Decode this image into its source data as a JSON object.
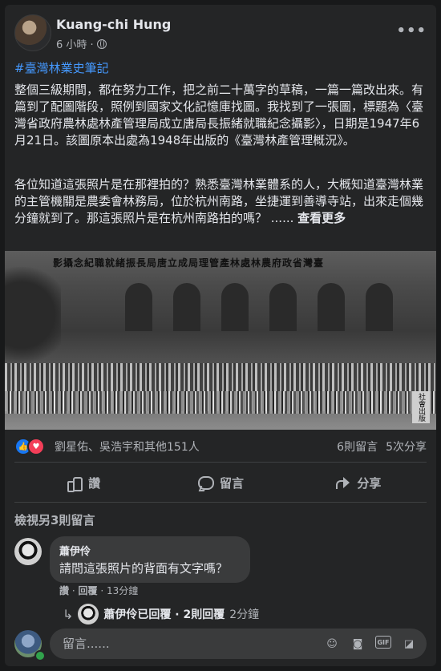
{
  "post": {
    "author": "Kuang-chi Hung",
    "time": "6 小時 ·",
    "hashtag": "#臺灣林業史筆記",
    "paragraph1": "整個三級期間，都在努力工作，把之前二十萬字的草稿，一篇一篇改出來。有篇到了配圖階段，照例到國家文化記憶庫找圖。我找到了一張圖，標題為〈臺灣省政府農林處林產管理局成立唐局長振緒就職紀念攝影〉，日期是1947年6月21日。該圖原本出處為1948年出版的《臺灣林產管理概況》。",
    "paragraph2": "各位知道這張照片是在那裡拍的？熟悉臺灣林業體系的人，大概知道臺灣林業的主管機關是農委會林務局，位於杭州南路，坐捷運到善導寺站，出來走個幾分鐘就到了。那這張照片是在杭州南路拍的嗎？ ......",
    "see_more": "查看更多",
    "photo_caption": "影攝念紀職就緒振長局唐立成局理管產林處林農府政省灣臺",
    "photo_stamp": "社會出版"
  },
  "stats": {
    "reaction_names": "劉星佑、吳浩宇和其他151人",
    "comments_count": "6則留言",
    "shares_count": "5次分享"
  },
  "actions": {
    "like": "讚",
    "comment": "留言",
    "share": "分享"
  },
  "comments": {
    "view_more": "檢視另3則留言",
    "first": {
      "name": "蕭伊伶",
      "text": "請問這張照片的背面有文字嗎？",
      "like": "讚",
      "reply": "回覆",
      "time": "13分鐘"
    },
    "reply_summary": {
      "text": "蕭伊伶已回覆 · 2則回覆",
      "time": "2分鐘"
    }
  },
  "composer": {
    "placeholder": "留言......"
  },
  "icons": {
    "more": "more-dots-icon",
    "privacy": "globe-icon",
    "like_reaction": "like-reaction-icon",
    "love_reaction": "love-reaction-icon",
    "emoji": "emoji-icon",
    "camera": "camera-icon",
    "gif": "gif-icon",
    "sticker": "sticker-icon"
  },
  "colors": {
    "background": "#18191a",
    "card": "#242526",
    "link": "#4599ff",
    "like": "#1877f2",
    "love": "#f33e58",
    "online": "#31a24c"
  }
}
